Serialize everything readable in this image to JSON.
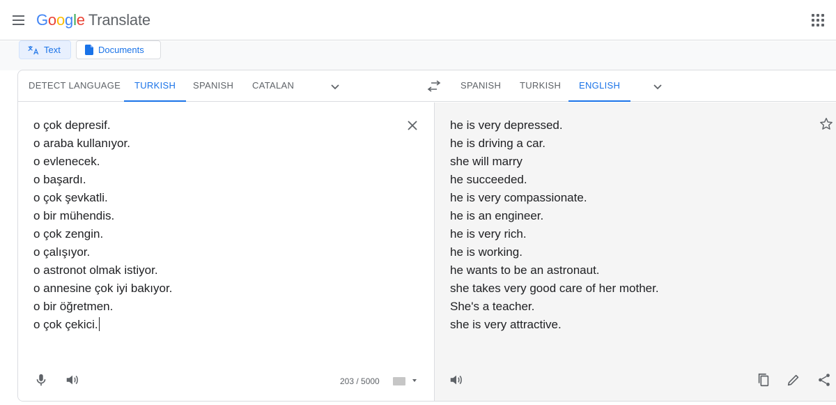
{
  "header": {
    "logo_google": [
      "G",
      "o",
      "o",
      "g",
      "l",
      "e"
    ],
    "logo_product": "Translate",
    "accent": "#1a73e8"
  },
  "modes": {
    "text_label": "Text",
    "documents_label": "Documents"
  },
  "source_languages": [
    "Detect language",
    "Turkish",
    "Spanish",
    "Catalan"
  ],
  "source_selected": "Turkish",
  "target_languages": [
    "Spanish",
    "Turkish",
    "English"
  ],
  "target_selected": "English",
  "source_lines": [
    "o çok depresif.",
    "o araba kullanıyor.",
    "o evlenecek.",
    "o başardı.",
    "o çok şevkatli.",
    "o bir mühendis.",
    "o çok zengin.",
    "o çalışıyor.",
    "o astronot olmak istiyor.",
    "o annesine çok iyi bakıyor.",
    "o bir öğretmen.",
    "o çok çekici."
  ],
  "target_lines": [
    "he is very depressed.",
    "he is driving a car.",
    "she will marry",
    "he succeeded.",
    "he is very compassionate.",
    "he is an engineer.",
    "he is very rich.",
    "he is working.",
    "he wants to be an astronaut.",
    "she takes very good care of her mother.",
    "She's a teacher.",
    "she is very attractive."
  ],
  "char_counter": "203 / 5000",
  "icons": {
    "menu": "hamburger-menu-icon",
    "apps": "apps-grid-icon",
    "swap": "swap-languages-icon",
    "clear": "close-icon",
    "star": "star-icon",
    "mic": "microphone-icon",
    "speaker": "speaker-icon",
    "keyboard": "keyboard-icon",
    "copy": "copy-icon",
    "edit": "pencil-icon",
    "share": "share-icon"
  }
}
